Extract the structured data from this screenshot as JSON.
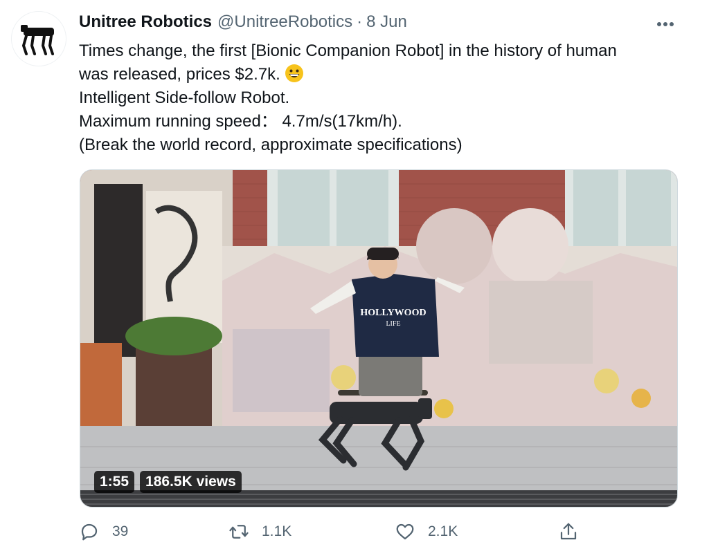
{
  "tweet": {
    "author": {
      "name": "Unitree Robotics",
      "handle": "@UnitreeRobotics",
      "separator": "·",
      "date": "8 Jun",
      "avatar_icon": "robot-dog-logo"
    },
    "more_icon": "more-dots-icon",
    "text_lines": [
      "Times change, the first [Bionic Companion Robot] in the history of human",
      "was released, prices $2.7k.",
      "Intelligent Side-follow Robot.",
      "Maximum running speed：  4.7m/s(17km/h).",
      "(Break the world record, approximate specifications)"
    ],
    "emoji": "grinning-face",
    "media": {
      "type": "video",
      "duration": "1:55",
      "views": "186.5K views",
      "shirt_text_line1": "HOLLYWOOD",
      "shirt_text_line2": "LIFE"
    },
    "actions": {
      "reply": {
        "icon": "reply-icon",
        "count": "39"
      },
      "retweet": {
        "icon": "retweet-icon",
        "count": "1.1K"
      },
      "like": {
        "icon": "heart-icon",
        "count": "2.1K"
      },
      "share": {
        "icon": "share-icon"
      }
    }
  }
}
